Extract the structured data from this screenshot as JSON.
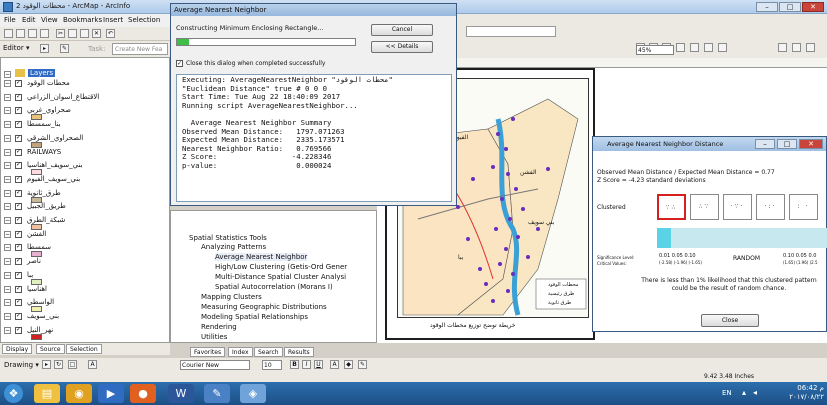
{
  "window": {
    "title": "محطات الوقود 2 - ArcMap - ArcInfo",
    "minimize": "–",
    "maximize": "□",
    "close": "✕"
  },
  "menu": [
    "File",
    "Edit",
    "View",
    "Bookmarks",
    "Insert",
    "Selection"
  ],
  "toolbar": {
    "editor": "Editor ▾",
    "task_label": "Task:",
    "create_new": "Create New Fea",
    "scale": "45%"
  },
  "toc": {
    "root": "Layers",
    "layers": [
      "محطات الوقود",
      "الاقتطاع_اسوان_الزراعي",
      "صحراوي_غربي",
      "بنا_سمسطا",
      "الصحراوي_الشرقي",
      "RAILWAYS",
      "بني_سويف_اهناسيا",
      "بني_سويف_الفيوم",
      "طرق_ثانوية",
      "طريق_الجبيل",
      "شبكة_الطرق",
      "الفشن",
      "سمسطا",
      "ناصر",
      "ببا",
      "اهناسيا",
      "الواسطي",
      "بني_سويف",
      "نهر_النيل"
    ],
    "tabs": [
      "Display",
      "Source",
      "Selection"
    ]
  },
  "catalog": {
    "items": [
      "Spatial Statistics Tools",
      "Analyzing Patterns",
      "Average Nearest Neighbor",
      "High/Low Clustering (Getis-Ord Gener",
      "Multi-Distance Spatial Cluster Analysi",
      "Spatial Autocorrelation (Morans I)",
      "Mapping Clusters",
      "Measuring Geographic Distributions",
      "Modeling Spatial Relationships",
      "Rendering",
      "Utilities"
    ],
    "tabs": [
      "Favorites",
      "Index",
      "Search",
      "Results"
    ]
  },
  "progress": {
    "title": "Average Nearest Neighbor",
    "status": "Constructing Minimum Enclosing Rectangle...",
    "progress_pct": 7,
    "cancel": "Cancel",
    "details": "<< Details",
    "close_check": "Close this dialog when completed successfully",
    "output": [
      "Executing: AverageNearestNeighbor \"محطات الوقود\"",
      "\"Euclidean Distance\" true # 0 0 0",
      "Start Time: Tue Aug 22 18:40:09 2017",
      "Running script AverageNearestNeighbor...",
      "",
      "  Average Nearest Neighbor Summary",
      "Observed Mean Distance:   1797.071263",
      "Expected Mean Distance:   2335.173571",
      "Nearest Neighbor Ratio:   0.769566",
      "Z Score:                 -4.228346",
      "p-value:                  0.000024"
    ]
  },
  "nnd": {
    "title": "Average Nearest Neighbor Distance",
    "ratio_line": "Observed Mean Distance / Expected Mean Distance = 0.77",
    "z_line": "Z Score = -4.23 standard deviations",
    "clustered": "Clustered",
    "random": "RANDOM",
    "sig_label": "Significance Level:",
    "crit_label": "Critical Values:",
    "sig_left": "0.01  0.05  0.10",
    "crit_left": "(-2.58) (-1.96) (-1.65)",
    "sig_right": "0.10  0.05  0.0",
    "crit_right": "(1.65)  (1.96)  (2.5",
    "note": "There is less than 1% likelihood that this clustered pattern could be the result of random chance.",
    "close": "Close",
    "win_min": "–",
    "win_max": "□",
    "win_close": "✕"
  },
  "map": {
    "labels": [
      "الفيوم",
      "بني سويف",
      "ببا",
      "الفشن"
    ],
    "legend": [
      "محطات الوقود",
      "طرق رئيسية",
      "طرق ثانوية"
    ],
    "footer": "خريطة توضح توزيع محطات الوقود"
  },
  "drawing": {
    "label": "Drawing ▾",
    "font": "Courier New",
    "size": "10"
  },
  "status": {
    "coords": "9.42  3.48 Inches"
  },
  "taskbar": {
    "lang": "EN",
    "time": "06:42 م",
    "date": "٢٠١٧/٠٨/٢٢"
  }
}
